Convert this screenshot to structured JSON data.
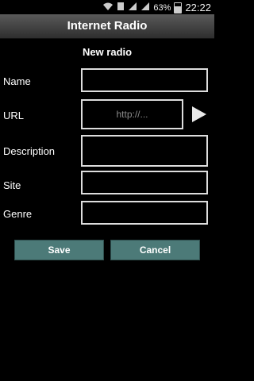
{
  "status_bar": {
    "battery": "63%",
    "time": "22:22",
    "icons": [
      "wifi-icon",
      "sim-icon",
      "signal-icon",
      "signal-icon",
      "battery-icon"
    ]
  },
  "app": {
    "title": "Internet Radio"
  },
  "form": {
    "title": "New radio",
    "name_label": "Name",
    "url_label": "URL",
    "url_placeholder": "http://...",
    "description_label": "Description",
    "site_label": "Site",
    "genre_label": "Genre",
    "play_icon": "play-icon"
  },
  "buttons": {
    "save": "Save",
    "cancel": "Cancel"
  },
  "colors": {
    "button_bg": "#4c7a78",
    "appbar_top": "#5a5a5a",
    "field_border": "#dddddd"
  }
}
